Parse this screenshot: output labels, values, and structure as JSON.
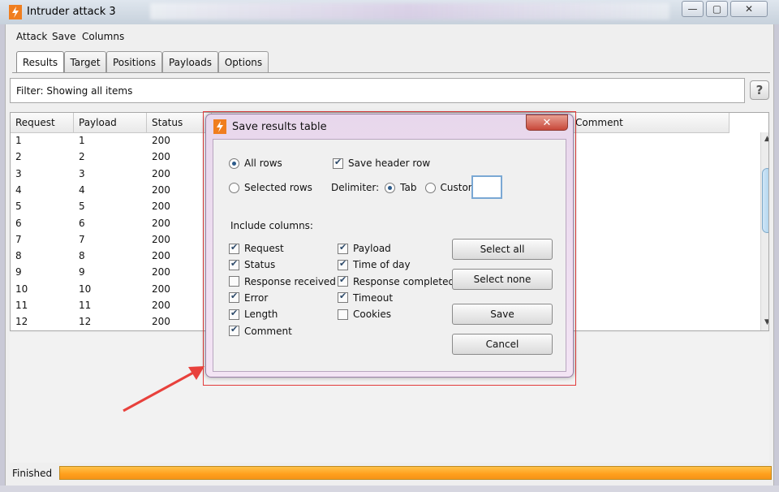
{
  "window": {
    "title": "Intruder attack 3",
    "minimize": "—",
    "maximize": "▢",
    "close": "✕"
  },
  "menu": [
    "Attack",
    "Save",
    "Columns"
  ],
  "tabs": [
    "Results",
    "Target",
    "Positions",
    "Payloads",
    "Options"
  ],
  "filter": {
    "text": "Filter:  Showing all items",
    "help": "?"
  },
  "table": {
    "columns": [
      "Request",
      "Payload",
      "Status",
      "Comment"
    ],
    "rows": [
      [
        "1",
        "1",
        "200"
      ],
      [
        "2",
        "2",
        "200"
      ],
      [
        "3",
        "3",
        "200"
      ],
      [
        "4",
        "4",
        "200"
      ],
      [
        "5",
        "5",
        "200"
      ],
      [
        "6",
        "6",
        "200"
      ],
      [
        "7",
        "7",
        "200"
      ],
      [
        "8",
        "8",
        "200"
      ],
      [
        "9",
        "9",
        "200"
      ],
      [
        "10",
        "10",
        "200"
      ],
      [
        "11",
        "11",
        "200"
      ],
      [
        "12",
        "12",
        "200"
      ]
    ]
  },
  "status": {
    "label": "Finished",
    "progress_fraction": 1.0
  },
  "dialog": {
    "title": "Save results table",
    "rows": {
      "all": "All rows",
      "selected": "Selected rows",
      "selected_value": "all"
    },
    "save_header_row": {
      "label": "Save header row",
      "checked": true
    },
    "delimiter": {
      "label": "Delimiter:",
      "tab": "Tab",
      "custom": "Custom:",
      "selected": "tab",
      "custom_value": ""
    },
    "include_columns_label": "Include columns:",
    "columns_left": [
      {
        "label": "Request",
        "checked": true
      },
      {
        "label": "Status",
        "checked": true
      },
      {
        "label": "Response received",
        "checked": false
      },
      {
        "label": "Error",
        "checked": true
      },
      {
        "label": "Length",
        "checked": true
      },
      {
        "label": "Comment",
        "checked": true
      }
    ],
    "columns_right": [
      {
        "label": "Payload",
        "checked": true
      },
      {
        "label": "Time of day",
        "checked": true
      },
      {
        "label": "Response completed",
        "checked": true
      },
      {
        "label": "Timeout",
        "checked": true
      },
      {
        "label": "Cookies",
        "checked": false
      }
    ],
    "buttons": {
      "select_all": "Select all",
      "select_none": "Select none",
      "save": "Save",
      "cancel": "Cancel"
    },
    "close": "✕"
  },
  "colors": {
    "accent_orange": "#ff9f1c",
    "highlight_red": "#e23b3b",
    "arrow_red": "#e8413c"
  }
}
